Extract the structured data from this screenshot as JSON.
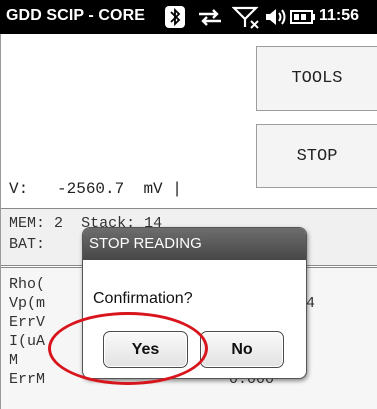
{
  "statusbar": {
    "app_title": "GDD SCIP - CORE",
    "clock": "11:56",
    "icons": [
      "bluetooth-icon",
      "data-sync-icon",
      "no-signal-icon",
      "volume-icon",
      "battery-icon"
    ]
  },
  "toolbar": {
    "tools_label": "TOOLS",
    "stop_label": "STOP"
  },
  "reading": {
    "label": "V:",
    "value": "-2560.7",
    "unit": "mV |"
  },
  "status_panel": {
    "mem_label": "MEM:",
    "mem_value": "2",
    "stack_label": "Stack:",
    "stack_value": "14",
    "bat_label": "BAT:"
  },
  "measurements": {
    "rows": [
      "Rho(",
      "Vp(m",
      "ErrV",
      "I(uA",
      "M",
      "ErrM"
    ],
    "vp_tail": "4",
    "errm_value": "0.000"
  },
  "dialog": {
    "title": "STOP READING",
    "message": "Confirmation?",
    "yes_label": "Yes",
    "no_label": "No"
  },
  "colors": {
    "statusbar_bg": "#000000",
    "dialog_title_bg": "#5a5a5a",
    "highlight": "#d8141c"
  }
}
